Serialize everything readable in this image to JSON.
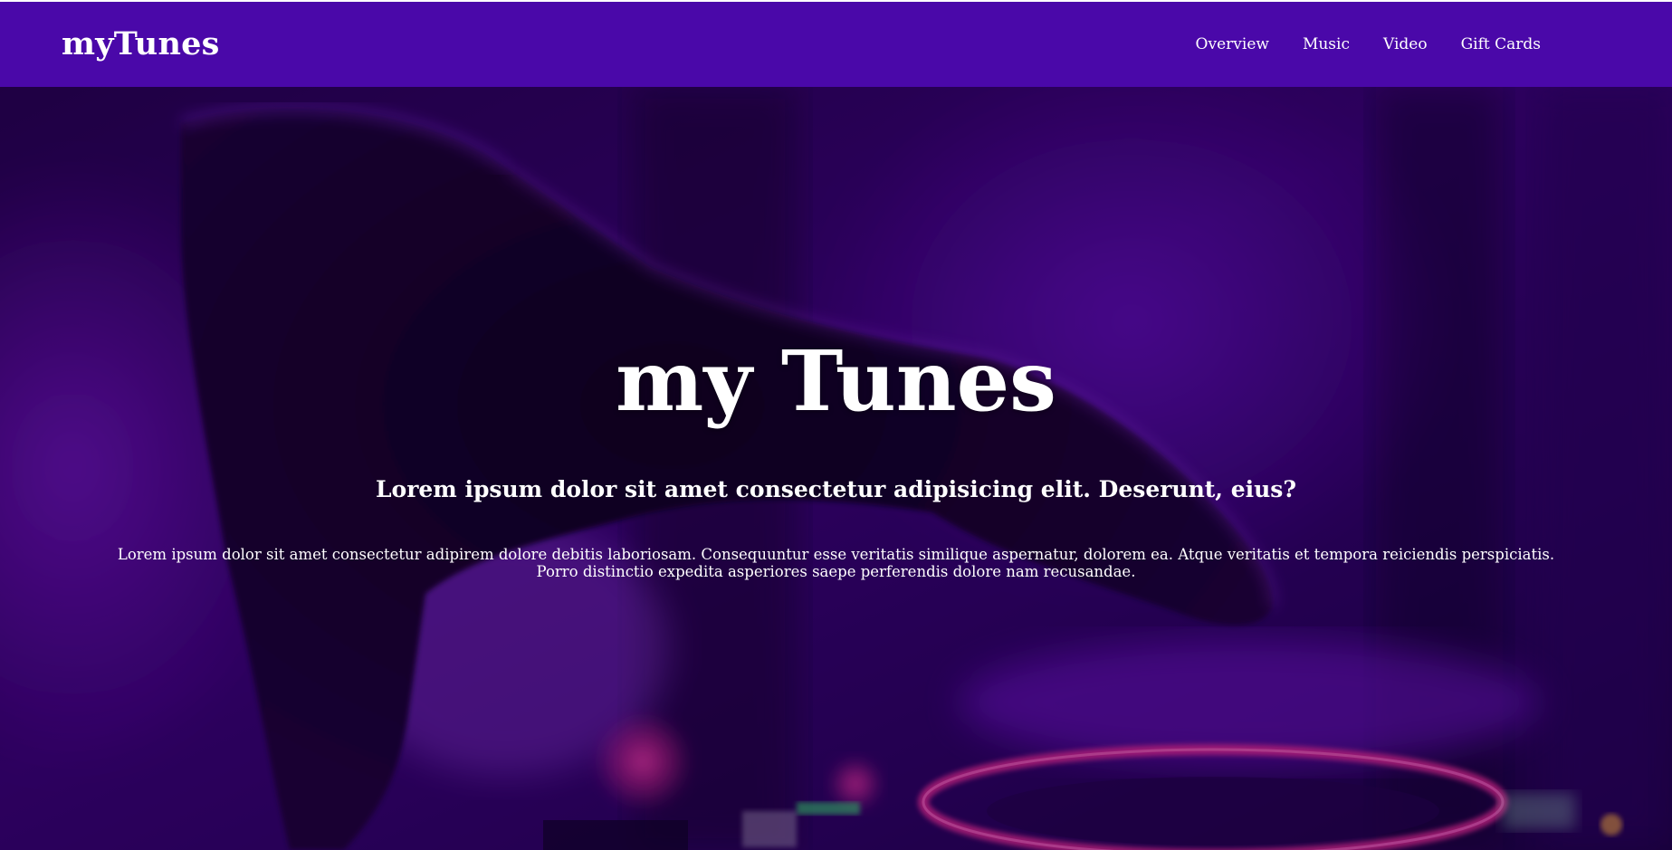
{
  "navbar": {
    "brand": "myTunes",
    "items": [
      {
        "label": "Overview"
      },
      {
        "label": "Music"
      },
      {
        "label": "Video"
      },
      {
        "label": "Gift Cards"
      }
    ],
    "color": "#4a08a9"
  },
  "hero": {
    "title": "my Tunes",
    "subtitle": "Lorem ipsum dolor sit amet consectetur adipisicing elit. Deserunt, eius?",
    "text": "Lorem ipsum dolor sit amet consectetur adipirem dolore debitis laboriosam. Consequuntur esse veritatis similique aspernatur, dolorem ea. Atque veritatis et tempora reiciendis perspiciatis. Porro distinctio expedita asperiores saepe perferendis dolore nam recusandae."
  },
  "background_image": {
    "subject": "dj-hand-over-turntable-photo",
    "accent": "#ff2aa0",
    "tint": "#3a007a"
  }
}
